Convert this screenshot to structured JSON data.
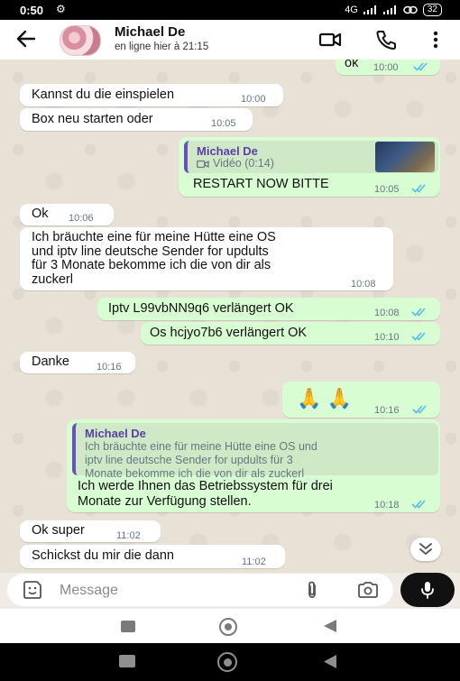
{
  "status_bar": {
    "time": "0:50",
    "network": "4G",
    "battery": "32"
  },
  "header": {
    "name": "Michael De",
    "status": "en ligne hier à 21:15"
  },
  "messages": [
    {
      "dir": "out",
      "text": "ok",
      "time": "10:00"
    },
    {
      "dir": "in",
      "text": "Kannst du die einspielen",
      "time": "10:00"
    },
    {
      "dir": "in",
      "text": "Box neu starten oder",
      "time": "10:05"
    },
    {
      "dir": "out",
      "quote_name": "Michael De",
      "quote_text": "Vidéo (0:14)",
      "text": "RESTART NOW BITTE",
      "time": "10:05"
    },
    {
      "dir": "in",
      "text": "Ok",
      "time": "10:06"
    },
    {
      "dir": "in",
      "lines": [
        "Ich bräuchte eine für meine Hütte eine OS",
        "und iptv line deutsche Sender for updults",
        "für 3 Monate bekomme ich die von dir als",
        "zuckerl"
      ],
      "time": "10:08"
    },
    {
      "dir": "out",
      "text": "Iptv L99vbNN9q6 verlängert  OK",
      "time": "10:08"
    },
    {
      "dir": "out",
      "text": "Os hcjyo7b6 verlängert  OK",
      "time": "10:10"
    },
    {
      "dir": "in",
      "text": "Danke",
      "time": "10:16"
    },
    {
      "dir": "out",
      "text": "🙏 🙏",
      "time": "10:16"
    },
    {
      "dir": "out",
      "quote_name": "Michael De",
      "quote_lines": [
        "Ich bräuchte eine für meine Hütte eine OS und",
        "iptv line deutsche Sender for updults für 3",
        "Monate bekomme ich die von dir als zuckerl"
      ],
      "lines": [
        "Ich werde Ihnen das Betriebssystem für drei",
        "Monate zur Verfügung stellen."
      ],
      "time": "10:18"
    },
    {
      "dir": "in",
      "text": "Ok super",
      "time": "11:02"
    },
    {
      "dir": "in",
      "text": "Schickst du mir die dann",
      "time": "11:02"
    }
  ],
  "composer": {
    "placeholder": "Message"
  }
}
